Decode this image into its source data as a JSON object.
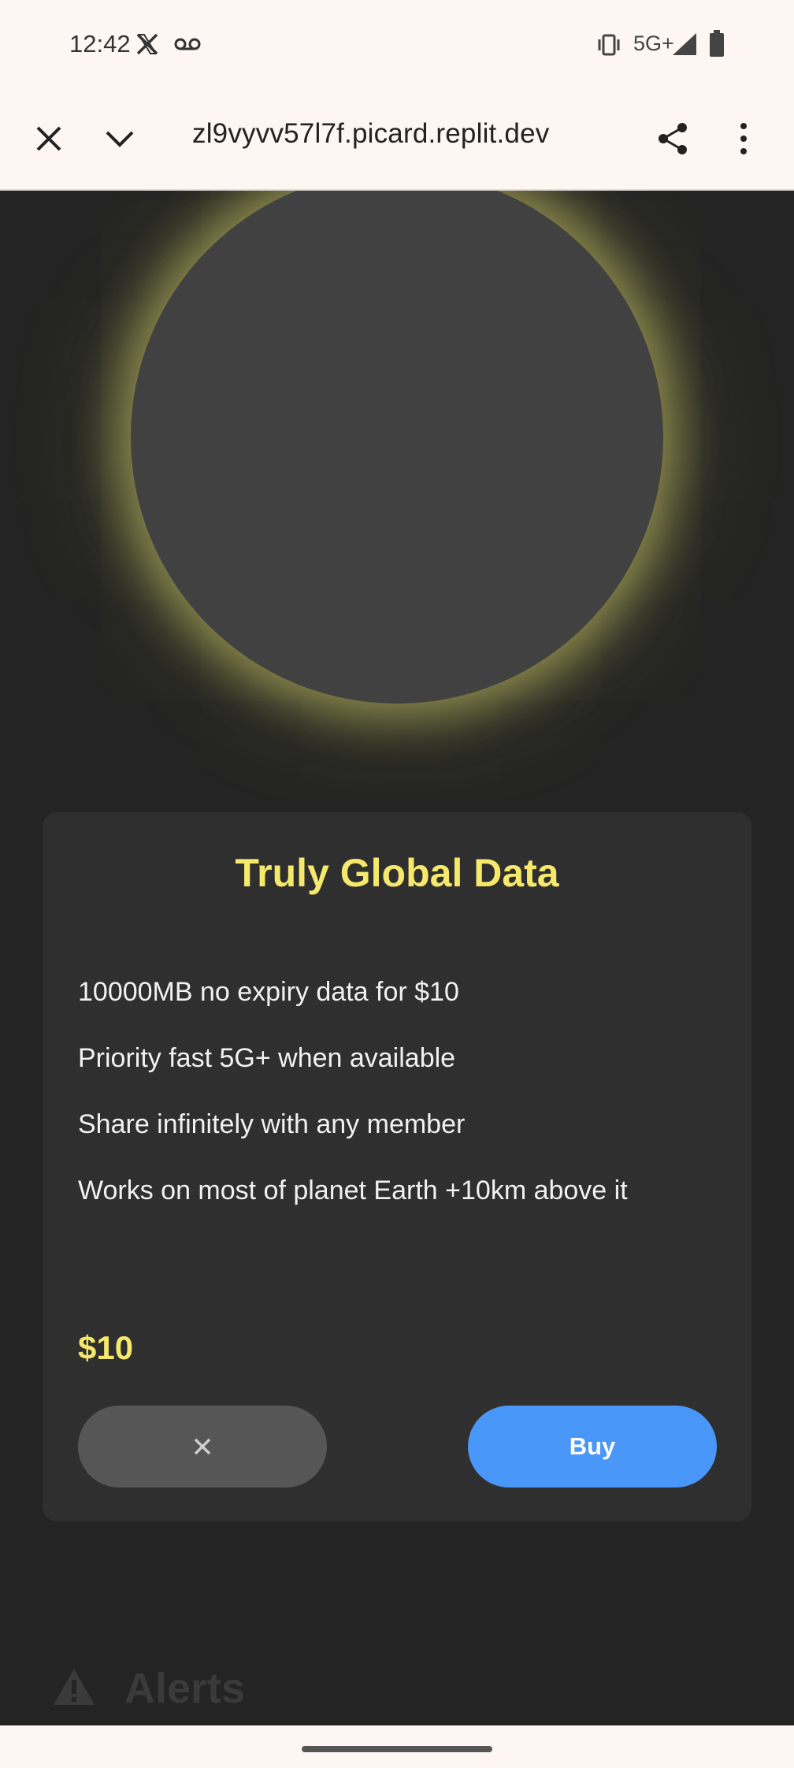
{
  "status_bar": {
    "time": "12:42",
    "network": "5G+",
    "icons": [
      "x-app-icon",
      "voicemail-icon",
      "vibrate-icon",
      "signal-icon",
      "battery-icon"
    ]
  },
  "browser": {
    "url": "zl9vyvv57l7f.picard.replit.dev",
    "icons": [
      "close-icon",
      "chevron-down-icon",
      "share-icon",
      "more-vert-icon"
    ]
  },
  "card": {
    "title": "Truly Global Data",
    "features": [
      "10000MB no expiry data for $10",
      "Priority fast 5G+ when available",
      "Share infinitely with any member",
      "Works on most of planet Earth +10km above it"
    ],
    "price": "$10",
    "cancel_label": "✕",
    "buy_label": "Buy"
  },
  "alerts": {
    "label": "Alerts",
    "icon": "warning-icon"
  },
  "colors": {
    "accent_yellow": "#f5e86b",
    "buy_blue": "#4997f8",
    "background": "#242424",
    "card": "#2f2f2f"
  }
}
